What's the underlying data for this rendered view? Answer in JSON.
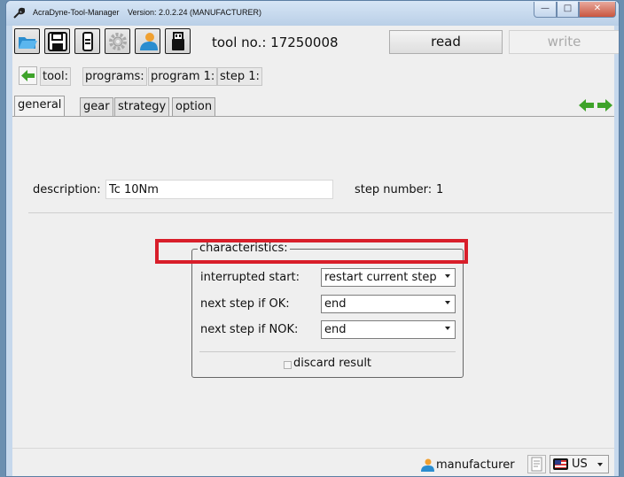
{
  "window": {
    "app_name": "AcraDyne-Tool-Manager",
    "version_text": "Version: 2.0.2.24  (MANUFACTURER)"
  },
  "toolbar": {
    "icons": [
      "folder-open-icon",
      "save-icon",
      "tool-device-icon",
      "gear-icon",
      "user-icon",
      "usb-icon"
    ],
    "tool_no_label": "tool no.: 17250008",
    "read_label": "read",
    "write_label": "write"
  },
  "breadcrumb": {
    "items": [
      "tool:",
      "programs:",
      "program 1:",
      "step 1:"
    ]
  },
  "tabs": {
    "items": [
      "general",
      "gear",
      "strategy",
      "option"
    ],
    "active": "general"
  },
  "general": {
    "description_label": "description:",
    "description_value": "Tc 10Nm",
    "step_number_label": "step number:",
    "step_number_value": "1"
  },
  "characteristics": {
    "title": "characteristics:",
    "rows": [
      {
        "label": "interrupted start:",
        "value": "restart current step"
      },
      {
        "label": "next step if OK:",
        "value": "end"
      },
      {
        "label": "next step if NOK:",
        "value": "end"
      }
    ],
    "discard_label": "discard result",
    "discard_checked": false
  },
  "statusbar": {
    "user_label": "manufacturer",
    "language_label": "US"
  },
  "colors": {
    "highlight": "#d81e2a",
    "arrow_green": "#3ea32a",
    "title_bar": "#c6d8ec"
  }
}
